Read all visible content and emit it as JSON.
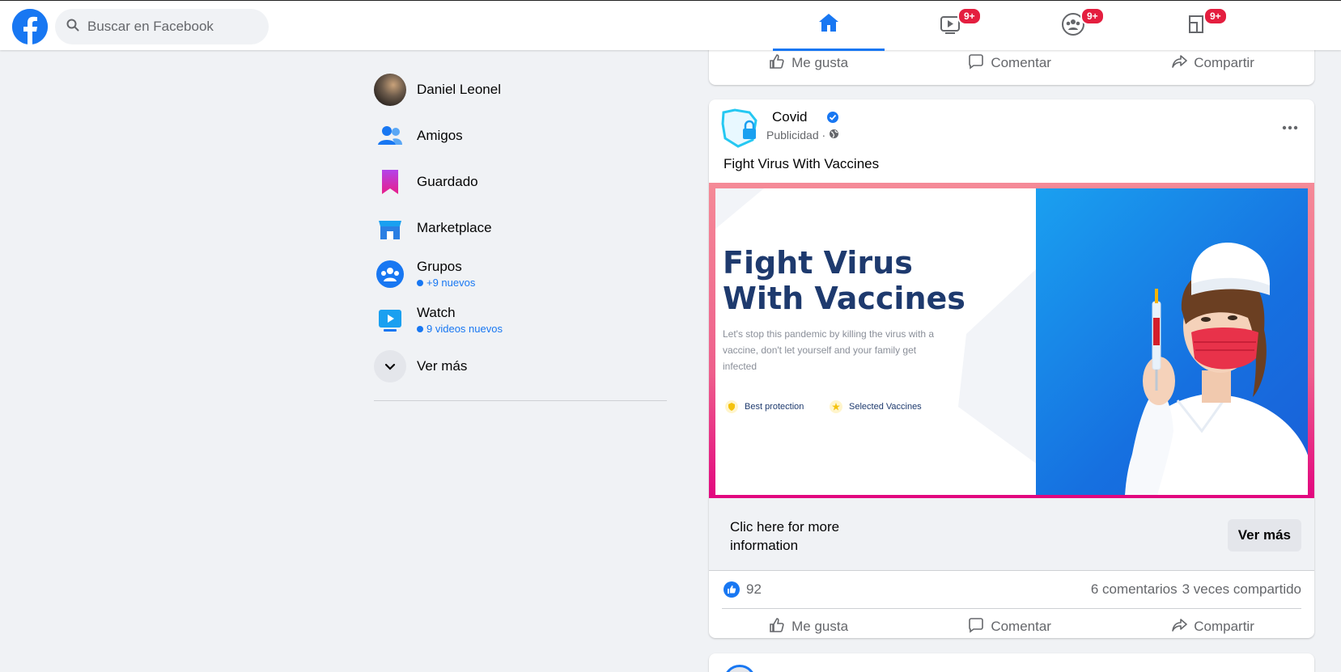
{
  "search": {
    "placeholder": "Buscar en Facebook"
  },
  "nav": {
    "tabs": [
      {
        "name": "home",
        "badge": ""
      },
      {
        "name": "watch",
        "badge": "9+"
      },
      {
        "name": "groups",
        "badge": "9+"
      },
      {
        "name": "gaming",
        "badge": "9+"
      }
    ]
  },
  "sidebar": {
    "items": [
      {
        "label": "Daniel Leonel",
        "sub": ""
      },
      {
        "label": "Amigos",
        "sub": ""
      },
      {
        "label": "Guardado",
        "sub": ""
      },
      {
        "label": "Marketplace",
        "sub": ""
      },
      {
        "label": "Grupos",
        "sub": "+9 nuevos"
      },
      {
        "label": "Watch",
        "sub": "9 videos nuevos"
      },
      {
        "label": "Ver más",
        "sub": ""
      }
    ]
  },
  "actions": {
    "like": "Me gusta",
    "comment": "Comentar",
    "share": "Compartir"
  },
  "post": {
    "author": "Covid",
    "meta": "Publicidad ·",
    "text": "Fight Virus With Vaccines",
    "ad": {
      "title_line1": "Fight Virus",
      "title_line2": "With Vaccines",
      "description": "Let's stop this pandemic by killing the virus with a vaccine, don't let yourself and your family get infected",
      "feature1": "Best protection",
      "feature2": "Selected Vaccines"
    },
    "cta_text": "Clic here for more information",
    "cta_button": "Ver más",
    "likes": "92",
    "comments": "6 comentarios",
    "shares": "3 veces compartido"
  },
  "colors": {
    "brand": "#1877f2",
    "badge": "#e41e3f",
    "ad_border": "#e2067f"
  }
}
